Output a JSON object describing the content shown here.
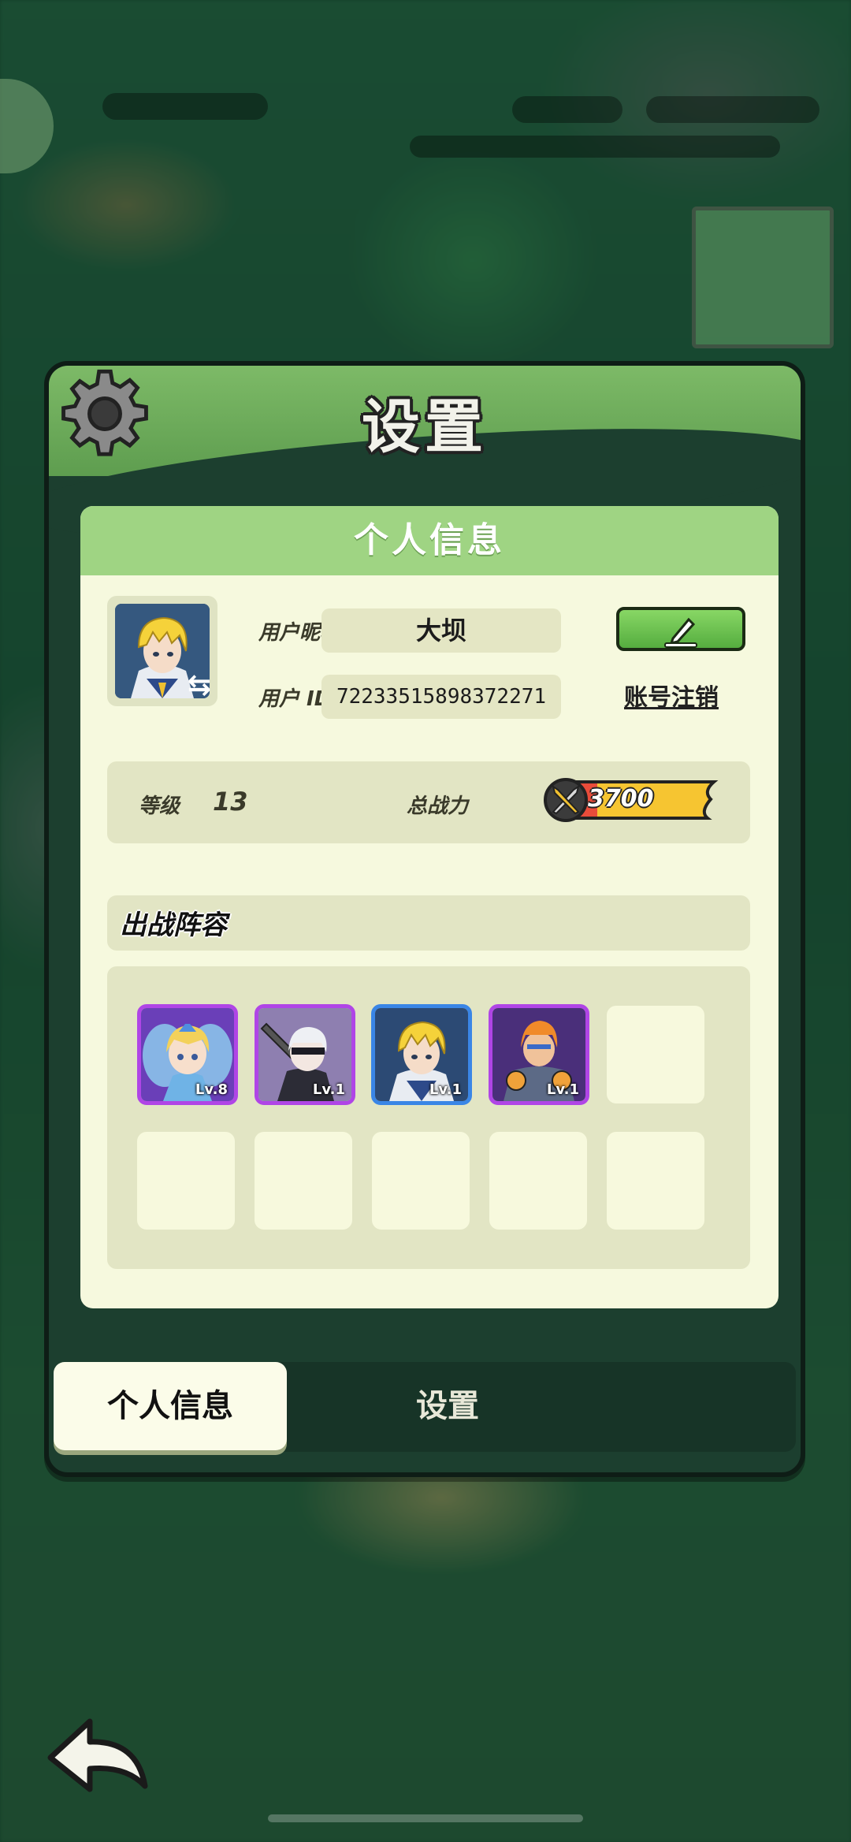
{
  "panel": {
    "title": "设置"
  },
  "personal_info": {
    "header": "个人信息",
    "nickname_label": "用户昵称",
    "nickname_value": "大坝",
    "id_label": "用户  ID",
    "id_value": "72233515898372271",
    "cancel_account": "账号注销",
    "level_label": "等级",
    "level_value": "13",
    "power_label": "总战力",
    "power_value": "3700"
  },
  "lineup": {
    "title": "出战阵容",
    "heroes": [
      {
        "name": "fairy-hero",
        "level": "Lv.8",
        "rarity_color": "#b045e6"
      },
      {
        "name": "masked-swordswoman-hero",
        "level": "Lv.1",
        "rarity_color": "#b045e6"
      },
      {
        "name": "blonde-knight-hero",
        "level": "Lv.1",
        "rarity_color": "#3a86e6"
      },
      {
        "name": "orange-warrior-hero",
        "level": "Lv.1",
        "rarity_color": "#b045e6"
      }
    ],
    "empty_slots": 6
  },
  "tabs": {
    "personal": "个人信息",
    "settings": "设置"
  },
  "icons": [
    "gear-icon",
    "pencil-icon",
    "swap-icon",
    "sword-icon",
    "back-arrow-icon"
  ],
  "colors": {
    "header_green": "#7dba67",
    "card_bg": "#f6f9de",
    "power_yellow": "#f6c531",
    "edit_green": "#6cc650"
  }
}
